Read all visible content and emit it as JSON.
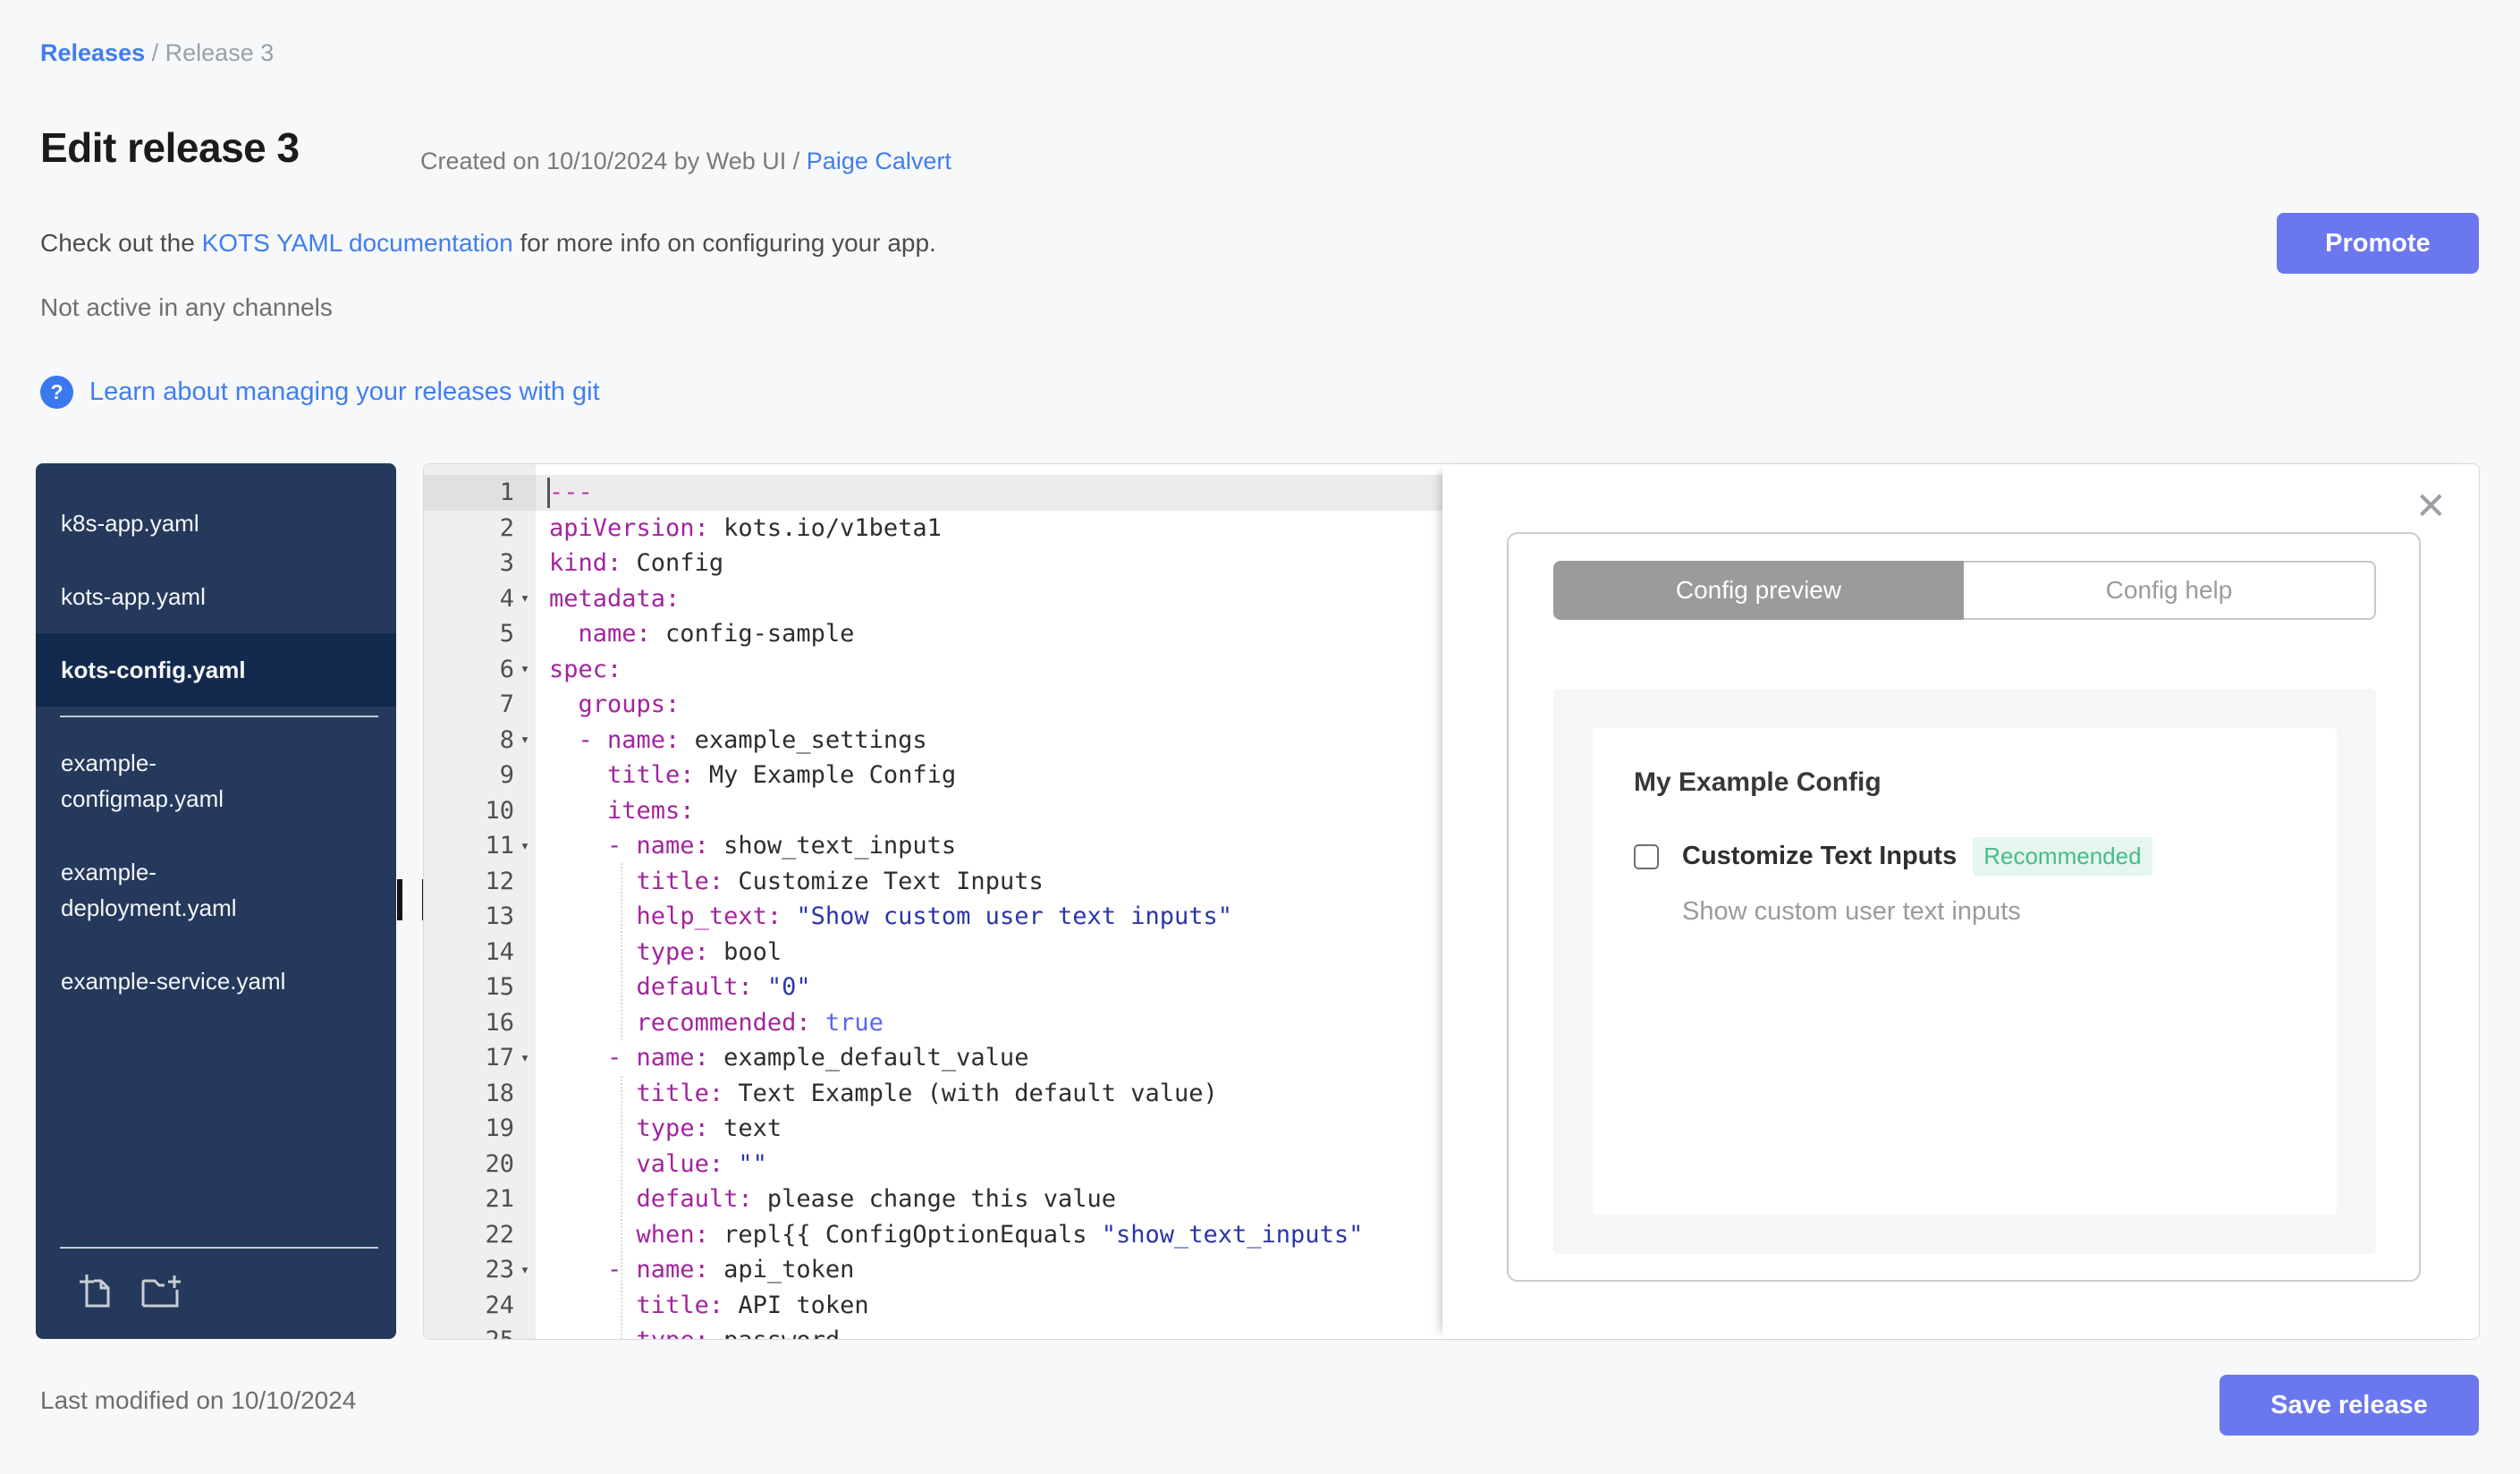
{
  "breadcrumb": {
    "link": "Releases",
    "separator": "/",
    "current": "Release 3"
  },
  "header": {
    "title": "Edit release 3",
    "created_prefix": "Created on 10/10/2024 by Web UI /",
    "author_link": "Paige Calvert"
  },
  "docs_row": {
    "pre": "Check out the ",
    "link": "KOTS YAML documentation",
    "post": " for more info on configuring your app."
  },
  "status_line": "Not active in any channels",
  "git_help": {
    "icon": "question-icon",
    "label": "Learn about managing your releases with git"
  },
  "buttons": {
    "promote": "Promote",
    "save": "Save release"
  },
  "footer": {
    "last_modified": "Last modified on 10/10/2024"
  },
  "sidebar": {
    "files": [
      {
        "lines": [
          "k8s-app.yaml"
        ]
      },
      {
        "lines": [
          "kots-app.yaml"
        ]
      },
      {
        "lines": [
          "kots-config.yaml"
        ],
        "selected": true
      },
      {
        "type": "divider"
      },
      {
        "lines": [
          "example-",
          "configmap.yaml"
        ]
      },
      {
        "lines": [
          "example-",
          "deployment.yaml"
        ]
      },
      {
        "lines": [
          "example-service.yaml"
        ]
      }
    ],
    "bottom_icons": [
      "new-file-icon",
      "new-folder-icon"
    ]
  },
  "editor": {
    "active_line": 1,
    "lines": [
      {
        "fold": false,
        "t": [
          [
            "m",
            "---"
          ]
        ]
      },
      {
        "fold": false,
        "t": [
          [
            "k",
            "apiVersion:"
          ],
          [
            "p",
            " kots.io/v1beta1"
          ]
        ]
      },
      {
        "fold": false,
        "t": [
          [
            "k",
            "kind:"
          ],
          [
            "p",
            " Config"
          ]
        ]
      },
      {
        "fold": true,
        "t": [
          [
            "k",
            "metadata:"
          ]
        ]
      },
      {
        "fold": false,
        "t": [
          [
            "p",
            "  "
          ],
          [
            "k",
            "name:"
          ],
          [
            "p",
            " config-sample"
          ]
        ]
      },
      {
        "fold": true,
        "t": [
          [
            "k",
            "spec:"
          ]
        ]
      },
      {
        "fold": false,
        "t": [
          [
            "p",
            "  "
          ],
          [
            "k",
            "groups:"
          ]
        ]
      },
      {
        "fold": true,
        "t": [
          [
            "p",
            "  "
          ],
          [
            "k",
            "- name:"
          ],
          [
            "p",
            " example_settings"
          ]
        ]
      },
      {
        "fold": false,
        "t": [
          [
            "p",
            "    "
          ],
          [
            "k",
            "title:"
          ],
          [
            "p",
            " My Example Config"
          ]
        ]
      },
      {
        "fold": false,
        "t": [
          [
            "p",
            "    "
          ],
          [
            "k",
            "items:"
          ]
        ]
      },
      {
        "fold": true,
        "t": [
          [
            "p",
            "    "
          ],
          [
            "k",
            "- name:"
          ],
          [
            "p",
            " show_text_inputs"
          ]
        ]
      },
      {
        "fold": false,
        "t": [
          [
            "p",
            "      "
          ],
          [
            "k",
            "title:"
          ],
          [
            "p",
            " Customize Text Inputs"
          ]
        ]
      },
      {
        "fold": false,
        "t": [
          [
            "p",
            "      "
          ],
          [
            "k",
            "help_text:"
          ],
          [
            "s",
            " \"Show custom user text inputs\""
          ]
        ]
      },
      {
        "fold": false,
        "t": [
          [
            "p",
            "      "
          ],
          [
            "k",
            "type:"
          ],
          [
            "p",
            " bool"
          ]
        ]
      },
      {
        "fold": false,
        "t": [
          [
            "p",
            "      "
          ],
          [
            "k",
            "default:"
          ],
          [
            "s",
            " \"0\""
          ]
        ]
      },
      {
        "fold": false,
        "t": [
          [
            "p",
            "      "
          ],
          [
            "k",
            "recommended:"
          ],
          [
            "b",
            " true"
          ]
        ]
      },
      {
        "fold": true,
        "t": [
          [
            "p",
            "    "
          ],
          [
            "k",
            "- name:"
          ],
          [
            "p",
            " example_default_value"
          ]
        ]
      },
      {
        "fold": false,
        "t": [
          [
            "p",
            "      "
          ],
          [
            "k",
            "title:"
          ],
          [
            "p",
            " Text Example (with default value)"
          ]
        ]
      },
      {
        "fold": false,
        "t": [
          [
            "p",
            "      "
          ],
          [
            "k",
            "type:"
          ],
          [
            "p",
            " text"
          ]
        ]
      },
      {
        "fold": false,
        "t": [
          [
            "p",
            "      "
          ],
          [
            "k",
            "value:"
          ],
          [
            "s",
            " \"\""
          ]
        ]
      },
      {
        "fold": false,
        "t": [
          [
            "p",
            "      "
          ],
          [
            "k",
            "default:"
          ],
          [
            "p",
            " please change this value"
          ]
        ]
      },
      {
        "fold": false,
        "t": [
          [
            "p",
            "      "
          ],
          [
            "k",
            "when:"
          ],
          [
            "p",
            " repl{{ ConfigOptionEquals "
          ],
          [
            "s",
            "\"show_text_inputs\""
          ]
        ]
      },
      {
        "fold": true,
        "t": [
          [
            "p",
            "    "
          ],
          [
            "k",
            "- name:"
          ],
          [
            "p",
            " api_token"
          ]
        ]
      },
      {
        "fold": false,
        "t": [
          [
            "p",
            "      "
          ],
          [
            "k",
            "title:"
          ],
          [
            "p",
            " API token"
          ]
        ]
      },
      {
        "fold": false,
        "t": [
          [
            "p",
            "      "
          ],
          [
            "k",
            "type:"
          ],
          [
            "p",
            " password"
          ]
        ]
      }
    ]
  },
  "preview": {
    "close_icon": "close-icon",
    "tabs": [
      {
        "label": "Config preview",
        "active": true
      },
      {
        "label": "Config help",
        "active": false
      }
    ],
    "group_title": "My Example Config",
    "item": {
      "label": "Customize Text Inputs",
      "badge": "Recommended",
      "help_text": "Show custom user text inputs",
      "checked": false
    }
  },
  "colors": {
    "accent": "#6b77ef",
    "link": "#3f7ef0",
    "sidebar_bg": "#24395b",
    "sidebar_selected": "#132a4e",
    "badge_green": "#47bb8b",
    "badge_bg": "#e4f6ee",
    "tab_active_gray": "#9b9b9b",
    "token_key": "#a2249e",
    "token_string": "#2b35a8",
    "token_bool": "#5a66f0",
    "token_meta": "#b83bb0"
  }
}
